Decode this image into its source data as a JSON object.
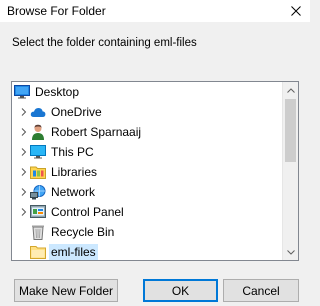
{
  "window": {
    "title": "Browse For Folder",
    "instruction": "Select the folder containing eml-files"
  },
  "tree": {
    "items": [
      {
        "label": "Desktop",
        "icon": "desktop-icon",
        "expandable": false,
        "selected": false,
        "level": 0
      },
      {
        "label": "OneDrive",
        "icon": "onedrive-icon",
        "expandable": true,
        "selected": false,
        "level": 1
      },
      {
        "label": "Robert Sparnaaij",
        "icon": "user-icon",
        "expandable": true,
        "selected": false,
        "level": 1
      },
      {
        "label": "This PC",
        "icon": "computer-icon",
        "expandable": true,
        "selected": false,
        "level": 1
      },
      {
        "label": "Libraries",
        "icon": "libraries-icon",
        "expandable": true,
        "selected": false,
        "level": 1
      },
      {
        "label": "Network",
        "icon": "network-icon",
        "expandable": true,
        "selected": false,
        "level": 1
      },
      {
        "label": "Control Panel",
        "icon": "control-panel-icon",
        "expandable": true,
        "selected": false,
        "level": 1
      },
      {
        "label": "Recycle Bin",
        "icon": "recycle-bin-icon",
        "expandable": false,
        "selected": false,
        "level": 1
      },
      {
        "label": "eml-files",
        "icon": "folder-icon",
        "expandable": false,
        "selected": true,
        "level": 1
      }
    ]
  },
  "buttons": {
    "make_new_folder": "Make New Folder",
    "ok": "OK",
    "cancel": "Cancel"
  },
  "colors": {
    "selection": "#cce8ff",
    "default_button_border": "#0078d7"
  }
}
